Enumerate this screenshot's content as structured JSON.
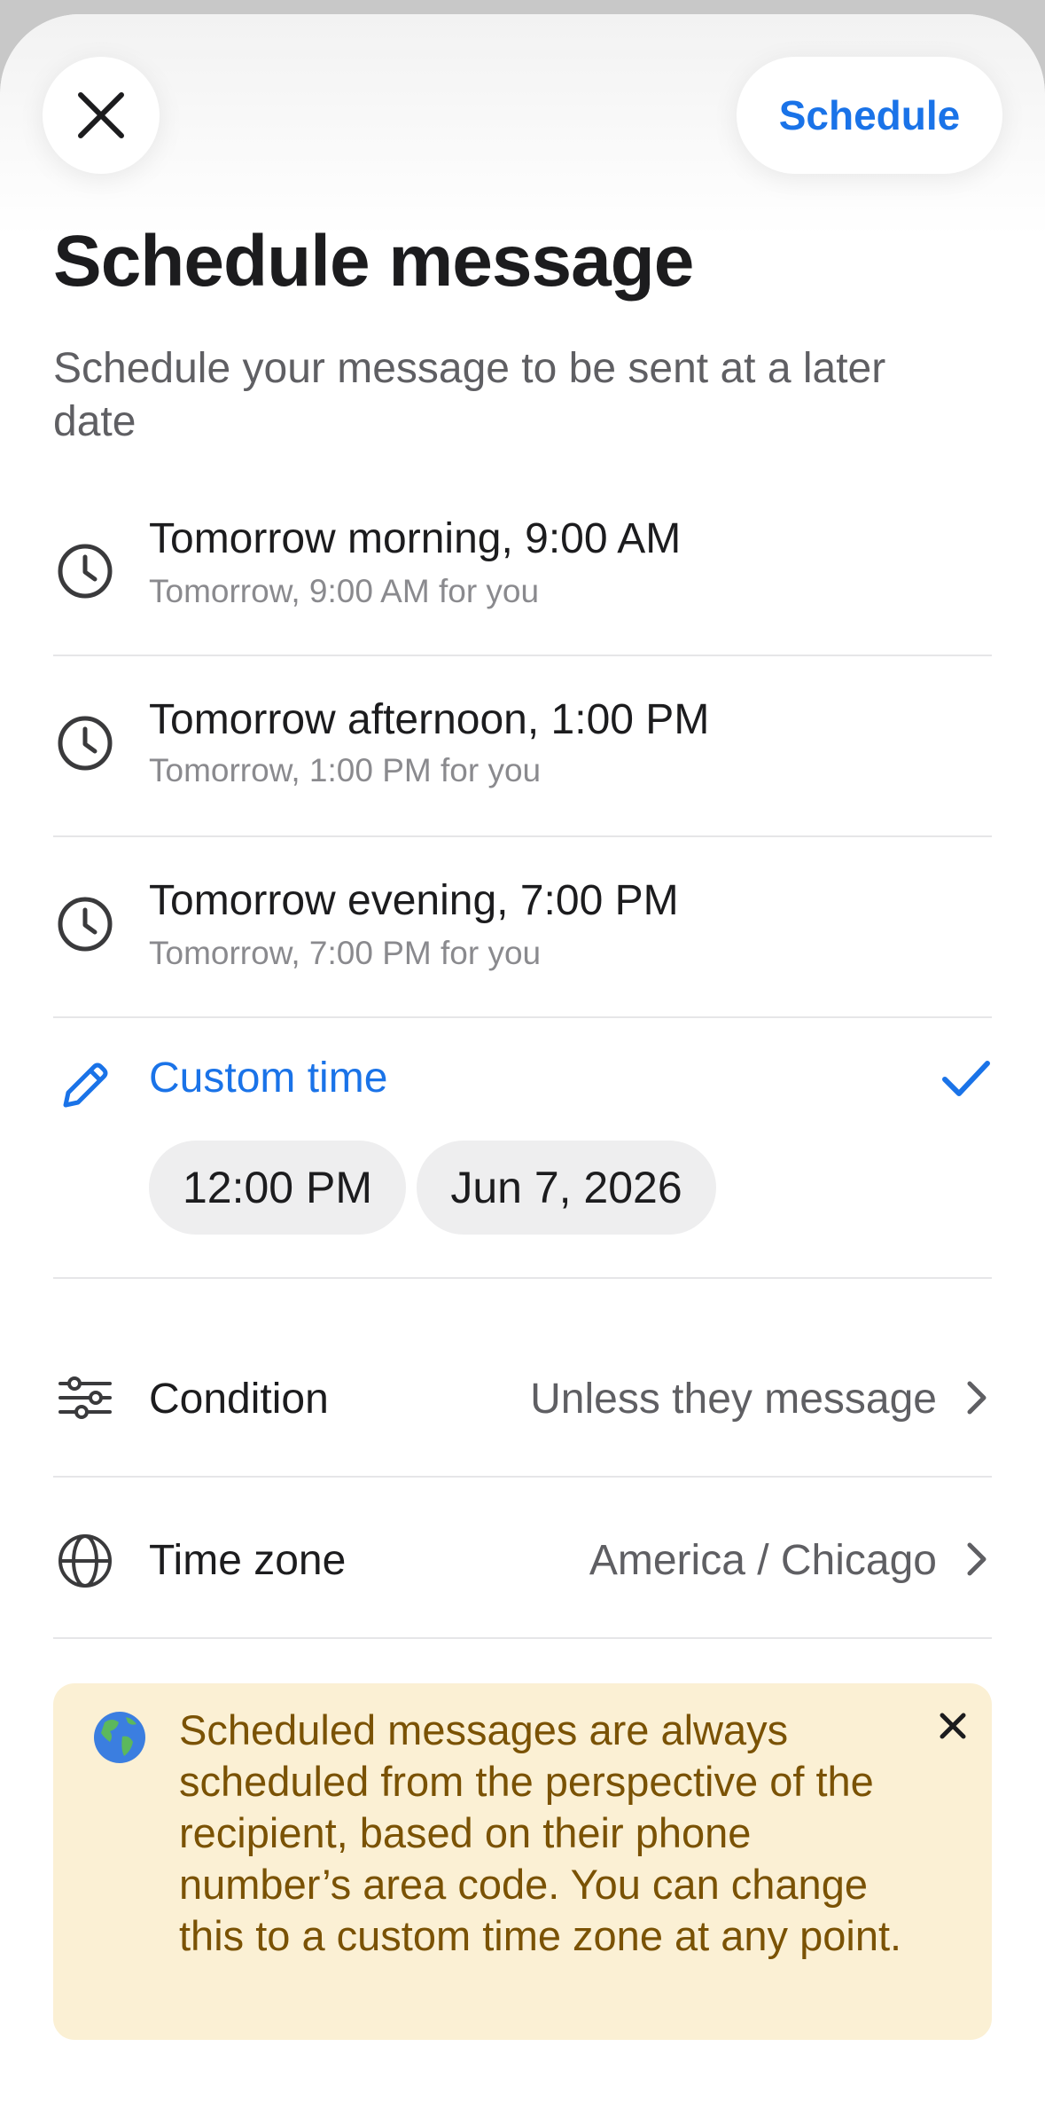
{
  "header": {
    "schedule_label": "Schedule"
  },
  "title": "Schedule message",
  "subtitle": "Schedule your message to be sent at a later date",
  "options": [
    {
      "label": "Tomorrow morning, 9:00 AM",
      "detail": "Tomorrow, 9:00 AM for you"
    },
    {
      "label": "Tomorrow afternoon, 1:00 PM",
      "detail": "Tomorrow, 1:00 PM for you"
    },
    {
      "label": "Tomorrow evening, 7:00 PM",
      "detail": "Tomorrow, 7:00 PM for you"
    }
  ],
  "custom": {
    "label": "Custom time",
    "time": "12:00 PM",
    "date": "Jun 7, 2026",
    "selected": true
  },
  "condition": {
    "label": "Condition",
    "value": "Unless they message"
  },
  "timezone": {
    "label": "Time zone",
    "value": "America / Chicago"
  },
  "banner": {
    "text": "Scheduled messages are always scheduled from the perspective of the recipient, based on their phone number’s area code. You can change this to a custom time zone at any point."
  },
  "colors": {
    "accent": "#1a73e8",
    "banner_bg": "#fbf0d4",
    "banner_text": "#7a5204"
  }
}
